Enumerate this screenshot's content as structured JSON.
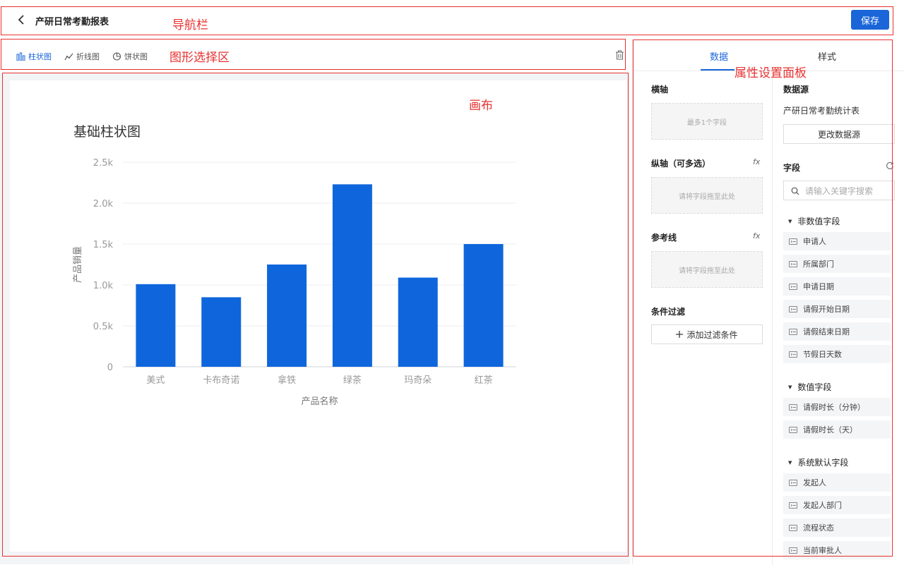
{
  "nav": {
    "title": "产研日常考勤报表",
    "save_label": "保存"
  },
  "chart_types": [
    {
      "label": "柱状图",
      "icon": "bar-chart-icon",
      "active": true
    },
    {
      "label": "折线图",
      "icon": "line-chart-icon",
      "active": false
    },
    {
      "label": "饼状图",
      "icon": "pie-chart-icon",
      "active": false
    }
  ],
  "annotations": {
    "nav": "导航栏",
    "chart_select": "图形选择区",
    "canvas": "画布",
    "properties": "属性设置面板"
  },
  "chart_data": {
    "type": "bar",
    "title": "基础柱状图",
    "xlabel": "产品名称",
    "ylabel": "产品销量",
    "categories": [
      "美式",
      "卡布奇诺",
      "拿铁",
      "绿茶",
      "玛奇朵",
      "红茶"
    ],
    "values": [
      1010,
      850,
      1250,
      2230,
      1090,
      1500
    ],
    "ylim": [
      0,
      2500
    ],
    "yticks": [
      0,
      500,
      1000,
      1500,
      2000,
      2500
    ],
    "ytick_labels": [
      "0",
      "0.5k",
      "1.0k",
      "1.5k",
      "2.0k",
      "2.5k"
    ],
    "bar_color": "#0f66dc",
    "grid": true
  },
  "panel": {
    "tabs": {
      "data": "数据",
      "style": "样式"
    },
    "x_axis": {
      "title": "横轴",
      "placeholder": "最多1个字段"
    },
    "y_axis": {
      "title": "纵轴（可多选）",
      "placeholder": "请将字段拖至此处",
      "fx": "fx"
    },
    "ref_line": {
      "title": "参考线",
      "placeholder": "请将字段拖至此处",
      "fx": "fx"
    },
    "filter": {
      "title": "条件过滤",
      "add_label": "添加过滤条件"
    },
    "datasource": {
      "title": "数据源",
      "name": "产研日常考勤统计表",
      "change_label": "更改数据源"
    },
    "fields": {
      "title": "字段",
      "search_placeholder": "请输入关键字搜索",
      "groups": [
        {
          "label": "非数值字段",
          "items": [
            "申请人",
            "所属部门",
            "申请日期",
            "请假开始日期",
            "请假结束日期",
            "节假日天数"
          ]
        },
        {
          "label": "数值字段",
          "items": [
            "请假时长（分钟）",
            "请假时长（天）"
          ]
        },
        {
          "label": "系统默认字段",
          "items": [
            "发起人",
            "发起人部门",
            "流程状态",
            "当前审批人"
          ]
        }
      ]
    }
  }
}
